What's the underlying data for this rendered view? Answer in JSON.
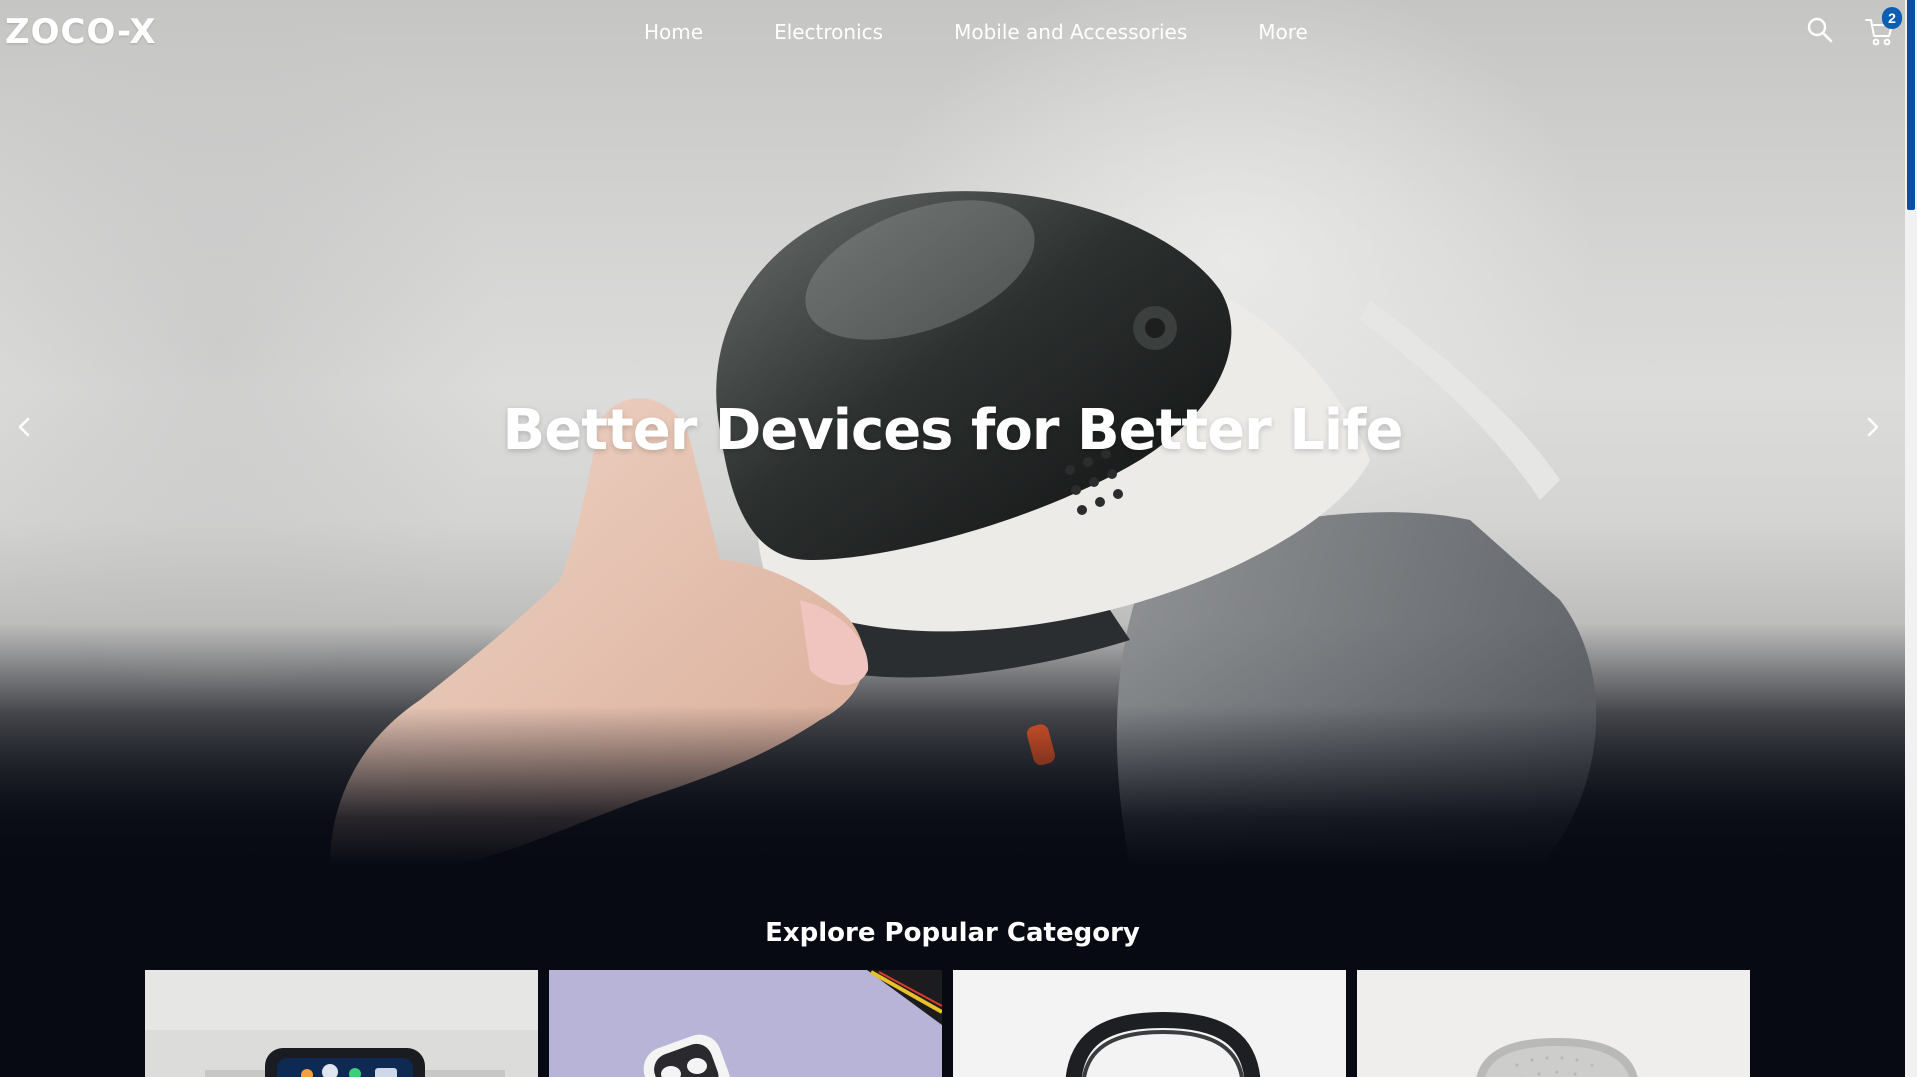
{
  "nav": {
    "logo": "ZOCO-X",
    "links": [
      {
        "label": "Home"
      },
      {
        "label": "Electronics"
      },
      {
        "label": "Mobile and Accessories"
      },
      {
        "label": "More"
      }
    ],
    "search_icon": "search-icon",
    "cart_icon": "cart-icon",
    "cart_count": "2"
  },
  "hero": {
    "title": "Better Devices for Better Life",
    "prev_icon": "chevron-left-icon",
    "next_icon": "chevron-right-icon"
  },
  "category": {
    "title": "Explore Popular Category",
    "cards": [
      {
        "name": "smartwatch"
      },
      {
        "name": "earbuds"
      },
      {
        "name": "headphones"
      },
      {
        "name": "smart-speaker"
      }
    ]
  },
  "colors": {
    "accent": "#0b4ea2",
    "badge": "#0b5fb3",
    "page_bg": "#070a13"
  }
}
